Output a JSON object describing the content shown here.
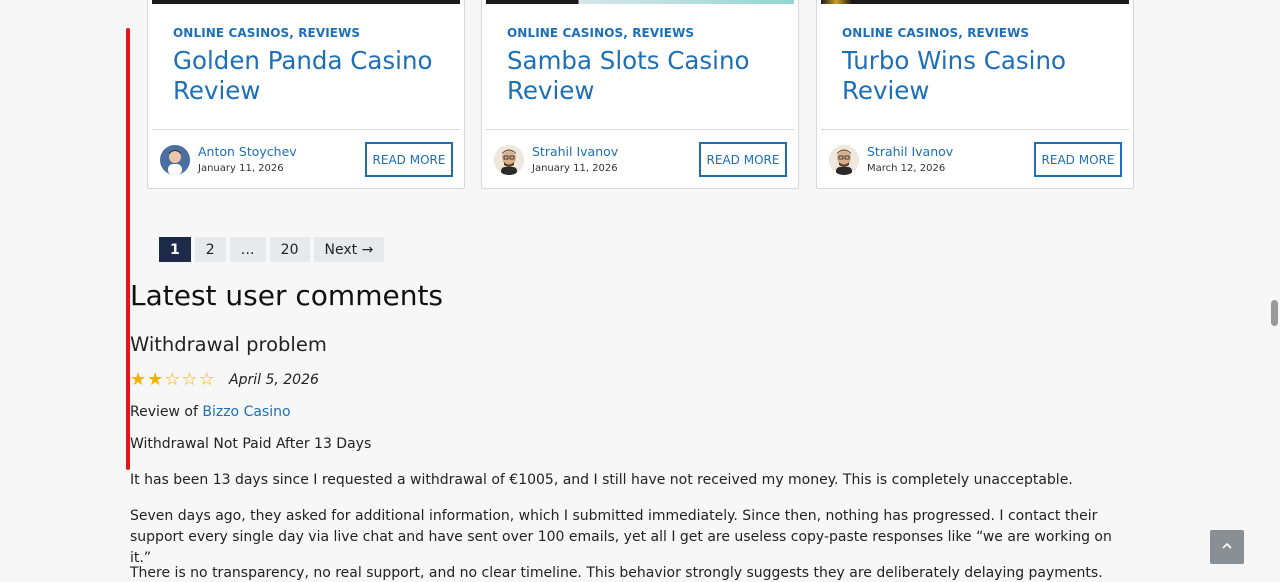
{
  "cards": [
    {
      "categories": [
        "ONLINE CASINOS",
        "REVIEWS"
      ],
      "title": "Golden Panda Casino Review",
      "author": "Anton Stoychev",
      "date": "January 11, 2026",
      "button": "READ MORE"
    },
    {
      "categories": [
        "ONLINE CASINOS",
        "REVIEWS"
      ],
      "title": "Samba Slots Casino Review",
      "author": "Strahil Ivanov",
      "date": "January 11, 2026",
      "button": "READ MORE"
    },
    {
      "categories": [
        "ONLINE CASINOS",
        "REVIEWS"
      ],
      "title": "Turbo Wins Casino Review",
      "author": "Strahil Ivanov",
      "date": "March 12, 2026",
      "button": "READ MORE"
    }
  ],
  "pagination": {
    "pages": [
      "1",
      "2",
      "…",
      "20",
      "Next →"
    ],
    "current": "1"
  },
  "comments_section": {
    "heading": "Latest user comments",
    "comment": {
      "title": "Withdrawal problem",
      "rating": 2,
      "rating_max": 5,
      "date": "April 5, 2026",
      "review_of_prefix": "Review of ",
      "review_of_link": "Bizzo Casino",
      "subject": "Withdrawal Not Paid After 13 Days",
      "paragraphs": [
        "It has been 13 days since I requested a withdrawal of €1005, and I still have not received my money. This is completely unacceptable.",
        "Seven days ago, they asked for additional information, which I submitted immediately. Since then, nothing has progressed. I contact their support every single day via live chat and have sent over 100 emails, yet all I get are useless copy-paste responses like “we are working on it.”",
        "There is no transparency, no real support, and no clear timeline. This behavior strongly suggests they are deliberately delaying payments."
      ]
    }
  },
  "scroll_top_icon": "chevron-up-icon",
  "colors": {
    "accent": "#1d6fb8",
    "annotation": "#e8141c",
    "star": "#f5b301",
    "active_page": "#1e2a4a"
  }
}
